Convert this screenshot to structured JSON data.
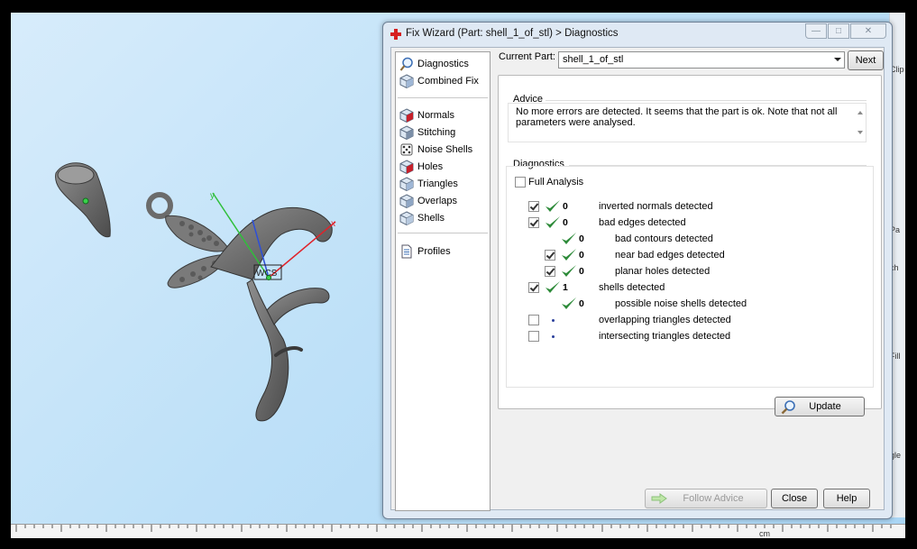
{
  "viewport": {
    "axis_label": "WCS",
    "ruler_unit": "cm",
    "side_texts": [
      "Clip",
      "Pa",
      "ch",
      "Fill",
      "gle"
    ]
  },
  "dialog": {
    "title": "Fix Wizard (Part: shell_1_of_stl) > Diagnostics",
    "nav": {
      "items": [
        {
          "label": "Diagnostics",
          "icon": "magnifier-icon"
        },
        {
          "label": "Combined Fix",
          "icon": "cube-icon"
        },
        {
          "label": "Normals",
          "icon": "cube-red-icon"
        },
        {
          "label": "Stitching",
          "icon": "cube-stitch-icon"
        },
        {
          "label": "Noise Shells",
          "icon": "dice-icon"
        },
        {
          "label": "Holes",
          "icon": "cube-hole-icon"
        },
        {
          "label": "Triangles",
          "icon": "cube-triangles-icon"
        },
        {
          "label": "Overlaps",
          "icon": "cube-overlap-icon"
        },
        {
          "label": "Shells",
          "icon": "cube-shells-icon"
        }
      ],
      "profiles_label": "Profiles"
    },
    "current_part_label": "Current Part:",
    "current_part_value": "shell_1_of_stl",
    "next_label": "Next",
    "advice": {
      "title": "Advice",
      "text": "No more errors are detected. It seems that the part is ok. Note that not all parameters were analysed."
    },
    "diagnostics": {
      "title": "Diagnostics",
      "full_analysis_label": "Full Analysis",
      "full_analysis_checked": false,
      "rows": [
        {
          "checkbox": true,
          "checked": true,
          "status": "ok",
          "count": "0",
          "label": "inverted normals detected",
          "indent": 0
        },
        {
          "checkbox": true,
          "checked": true,
          "status": "ok",
          "count": "0",
          "label": "bad edges detected",
          "indent": 0
        },
        {
          "checkbox": false,
          "checked": false,
          "status": "ok",
          "count": "0",
          "label": "bad contours detected",
          "indent": 1
        },
        {
          "checkbox": true,
          "checked": true,
          "status": "ok",
          "count": "0",
          "label": "near bad edges detected",
          "indent": 1
        },
        {
          "checkbox": true,
          "checked": true,
          "status": "ok",
          "count": "0",
          "label": "planar holes detected",
          "indent": 1
        },
        {
          "checkbox": true,
          "checked": true,
          "status": "ok",
          "count": "1",
          "label": "shells detected",
          "indent": 0
        },
        {
          "checkbox": false,
          "checked": false,
          "status": "ok",
          "count": "0",
          "label": "possible noise shells detected",
          "indent": 1
        },
        {
          "checkbox": true,
          "checked": false,
          "status": "pending",
          "count": "",
          "label": "overlapping triangles detected",
          "indent": 0
        },
        {
          "checkbox": true,
          "checked": false,
          "status": "pending",
          "count": "",
          "label": "intersecting triangles detected",
          "indent": 0
        }
      ],
      "update_label": "Update"
    },
    "footer": {
      "follow_advice_label": "Follow Advice",
      "close_label": "Close",
      "help_label": "Help"
    },
    "colors": {
      "tick_green": "#2e8b3a",
      "pending_dot": "#2a3f9b"
    }
  }
}
